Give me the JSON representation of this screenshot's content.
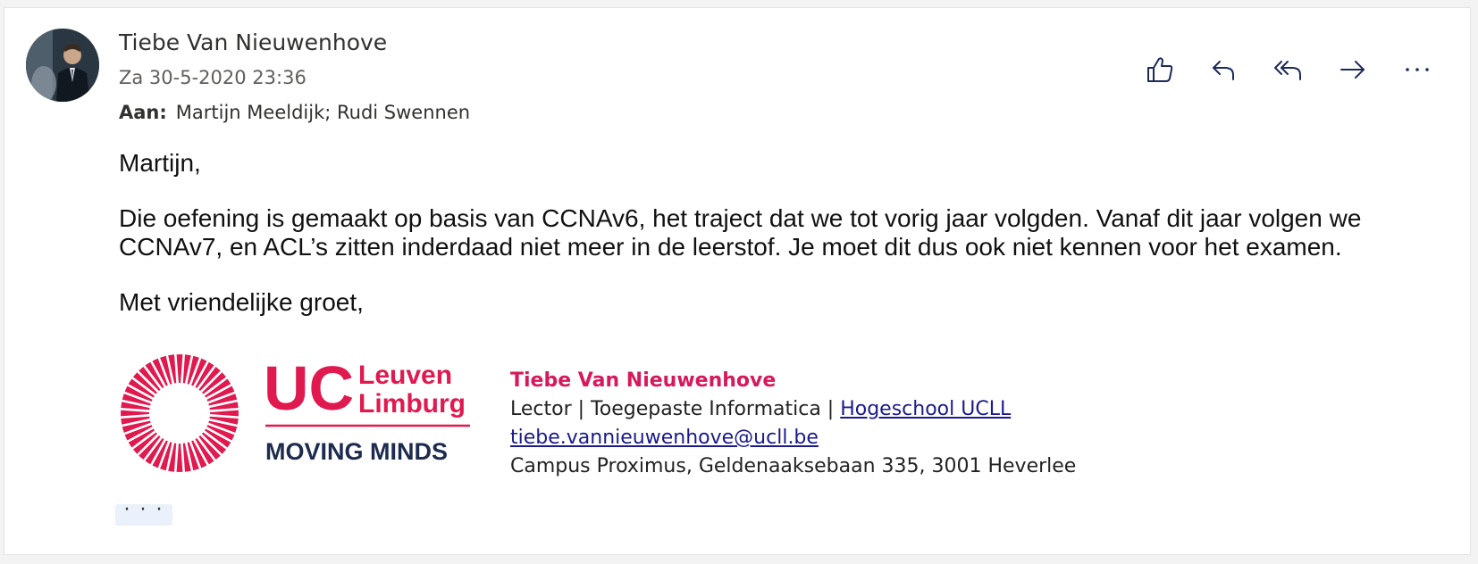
{
  "message": {
    "sender_name": "Tiebe Van Nieuwenhove",
    "sent_date": "Za 30-5-2020 23:36",
    "to_label": "Aan:",
    "to_value": "Martijn Meeldijk; Rudi Swennen"
  },
  "actions": [
    {
      "icon": "thumbs-up-icon"
    },
    {
      "icon": "reply-icon"
    },
    {
      "icon": "reply-all-icon"
    },
    {
      "icon": "forward-icon"
    },
    {
      "icon": "more-actions-icon"
    }
  ],
  "body": {
    "greeting": "Martijn,",
    "paragraph": "Die oefening is gemaakt op basis van CCNAv6, het traject dat we tot vorig jaar volgden. Vanaf dit jaar volgen we CCNAv7, en ACL’s zitten inderdaad niet meer in de leerstof. Je moet dit dus ook niet kennen voor het examen.",
    "closing": "Met vriendelijke groet,"
  },
  "logo": {
    "uc": "UC",
    "leuven": "Leuven",
    "limburg": "Limburg",
    "tagline": "MOVING MINDS",
    "brand_color": "#e0194f",
    "tagline_color": "#1d2b4f"
  },
  "signature": {
    "name": "Tiebe Van Nieuwenhove",
    "role": "Lector | Toegepaste Informatica | ",
    "org_link": "Hogeschool UCLL",
    "email": "tiebe.vannieuwenhove@ucll.be",
    "address": "Campus Proximus, Geldenaaksebaan 335, 3001 Heverlee",
    "name_color": "#d6195c"
  },
  "expand_label": "· · ·"
}
